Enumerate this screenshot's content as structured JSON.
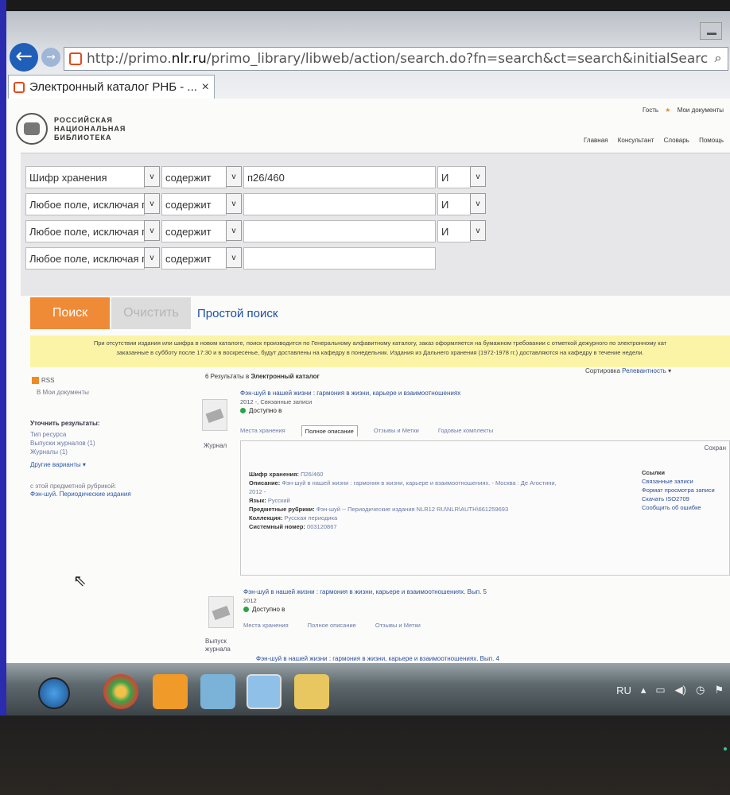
{
  "browser": {
    "url_prefix": "http://primo.",
    "url_domain": "nlr.ru",
    "url_rest": "/primo_library/libweb/action/search.do?fn=search&ct=search&initialSearch=true&mode=Advanced&",
    "tab_title": "Электронный каталог РНБ - ...",
    "back_icon": "←",
    "forward_icon": "→",
    "search_icon": "⌕",
    "tab_close": "×"
  },
  "header": {
    "logo_line1": "РОССИЙСКАЯ",
    "logo_line2": "НАЦИОНАЛЬНАЯ",
    "logo_line3": "БИБЛИОТЕКА",
    "guest": "Гость",
    "my_docs": "Мои документы",
    "nav": [
      "Главная",
      "Консультант",
      "Словарь",
      "Помощь"
    ]
  },
  "search": {
    "rows": [
      {
        "field": "Шифр хранения",
        "op": "содержит",
        "value": "п26/460",
        "bool": "И"
      },
      {
        "field": "Любое поле, исключая г",
        "op": "содержит",
        "value": "",
        "bool": "И"
      },
      {
        "field": "Любое поле, исключая г",
        "op": "содержит",
        "value": "",
        "bool": "И"
      },
      {
        "field": "Любое поле, исключая г",
        "op": "содержит",
        "value": ""
      }
    ],
    "dropdown_icon": "v",
    "search_label": "Поиск",
    "clear_label": "Очистить",
    "simple_label": "Простой поиск"
  },
  "notice": {
    "line1": "При отсутствии издания или шифра в новом каталоге, поиск производится по Генеральному алфавитному каталогу, заказ оформляется на бумажном требовании с отметкой дежурного по электронному кат",
    "line2": "заказанные в субботу после 17:30 и в воскресенье, будут доставлены на кафедру в понедельник. Издания из Дальнего хранения (1972-1978 гг.) доставляются на кафедру в течение недели."
  },
  "sidebar": {
    "rss": "RSS",
    "my_docs": "В Мои документы",
    "refine_title": "Уточнить результаты:",
    "refine_items": [
      "Тип ресурса",
      "Выпуски журналов (1)",
      "Журналы (1)"
    ],
    "more": "Другие варианты",
    "rubric_text": "с этой предметной рубрикой:",
    "rubric_link": "Фэн-шуй. Периодические издания"
  },
  "results": {
    "count_text": "6 Результаты в",
    "catalog": "Электронный каталог",
    "sort_label": "Сортировка",
    "sort_value": "Релевантность",
    "items": [
      {
        "title": "Фэн-шуй в нашей жизни : гармония в жизни, карьере и взаимоотношениях",
        "meta": "2012 -, Связанные записи",
        "availability": "Доступно в",
        "type": "Журнал",
        "tabs": [
          "Места хранения",
          "Полное описание",
          "Отзывы и Метки",
          "Годовые комплекты"
        ]
      },
      {
        "title": "Фэн-шуй в нашей жизни : гармония в жизни, карьере и взаимоотношениях. Вып. 5",
        "meta": "2012",
        "availability": "Доступно в",
        "type": "Выпуск журнала",
        "tabs": [
          "Места хранения",
          "Полное описание",
          "Отзывы и Метки"
        ]
      },
      {
        "title": "Фэн-шуй в нашей жизни : гармония в жизни, карьере и взаимоотношениях. Вып. 4"
      }
    ],
    "details": {
      "save": "Сохран",
      "fields": [
        {
          "label": "Шифр хранения:",
          "value": "П26/460"
        },
        {
          "label": "Описание:",
          "value": "Фэн-шуй в нашей жизни : гармония в жизни, карьере и взаимоотношениях. - Москва : Де Агостини, 2012 -"
        },
        {
          "label": "Язык:",
          "value": "Русский"
        },
        {
          "label": "Предметные рубрики:",
          "value": "Фэн-шуй -- Периодические издания NLR12 RU\\NLR\\AUTH\\661259693"
        },
        {
          "label": "Коллекция:",
          "value": "Русская периодика"
        },
        {
          "label": "Системный номер:",
          "value": "003120867"
        }
      ],
      "links_title": "Ссылки",
      "links": [
        "Связанные записи",
        "Формат просмотра записи",
        "Скачать ISO2709",
        "Сообщить об ошибке"
      ]
    }
  },
  "taskbar": {
    "lang": "RU"
  }
}
